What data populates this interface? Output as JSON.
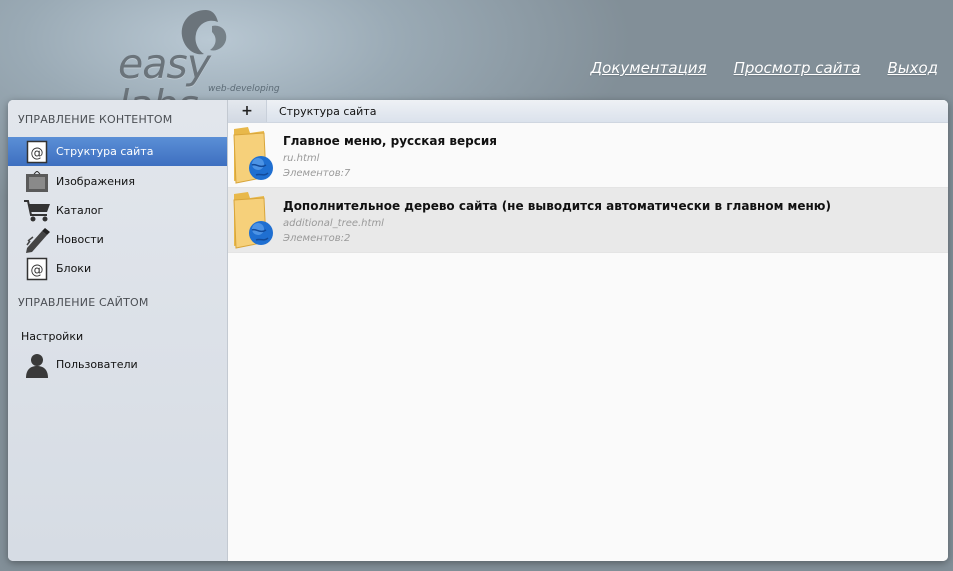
{
  "header": {
    "logo_text": "easy labs",
    "logo_sub": "web-developing",
    "links": [
      "Документация",
      "Просмотр сайта",
      "Выход"
    ]
  },
  "sidebar": {
    "section_content": "УПРАВЛЕНИЕ КОНТЕНТОМ",
    "content_items": [
      {
        "label": "Структура сайта",
        "icon": "at-sign-icon",
        "active": true
      },
      {
        "label": "Изображения",
        "icon": "picture-frame-icon",
        "active": false
      },
      {
        "label": "Каталог",
        "icon": "shopping-cart-icon",
        "active": false
      },
      {
        "label": "Новости",
        "icon": "pencil-icon",
        "active": false
      },
      {
        "label": "Блоки",
        "icon": "at-sign-icon",
        "active": false
      }
    ],
    "section_site": "УПРАВЛЕНИЕ САЙТОМ",
    "settings_label": "Настройки",
    "users_label": "Пользователи"
  },
  "toolbar": {
    "add_label": "+",
    "title": "Структура сайта"
  },
  "rows": [
    {
      "title": "Главное меню, русская версия",
      "url": "ru.html",
      "count": "Элементов:7"
    },
    {
      "title": "Дополнительное дерево сайта (не выводится автоматически в главном меню)",
      "url": "additional_tree.html",
      "count": "Элементов:2"
    }
  ],
  "colors": {
    "accent": "#4a7cc9",
    "background": "#848f97"
  }
}
